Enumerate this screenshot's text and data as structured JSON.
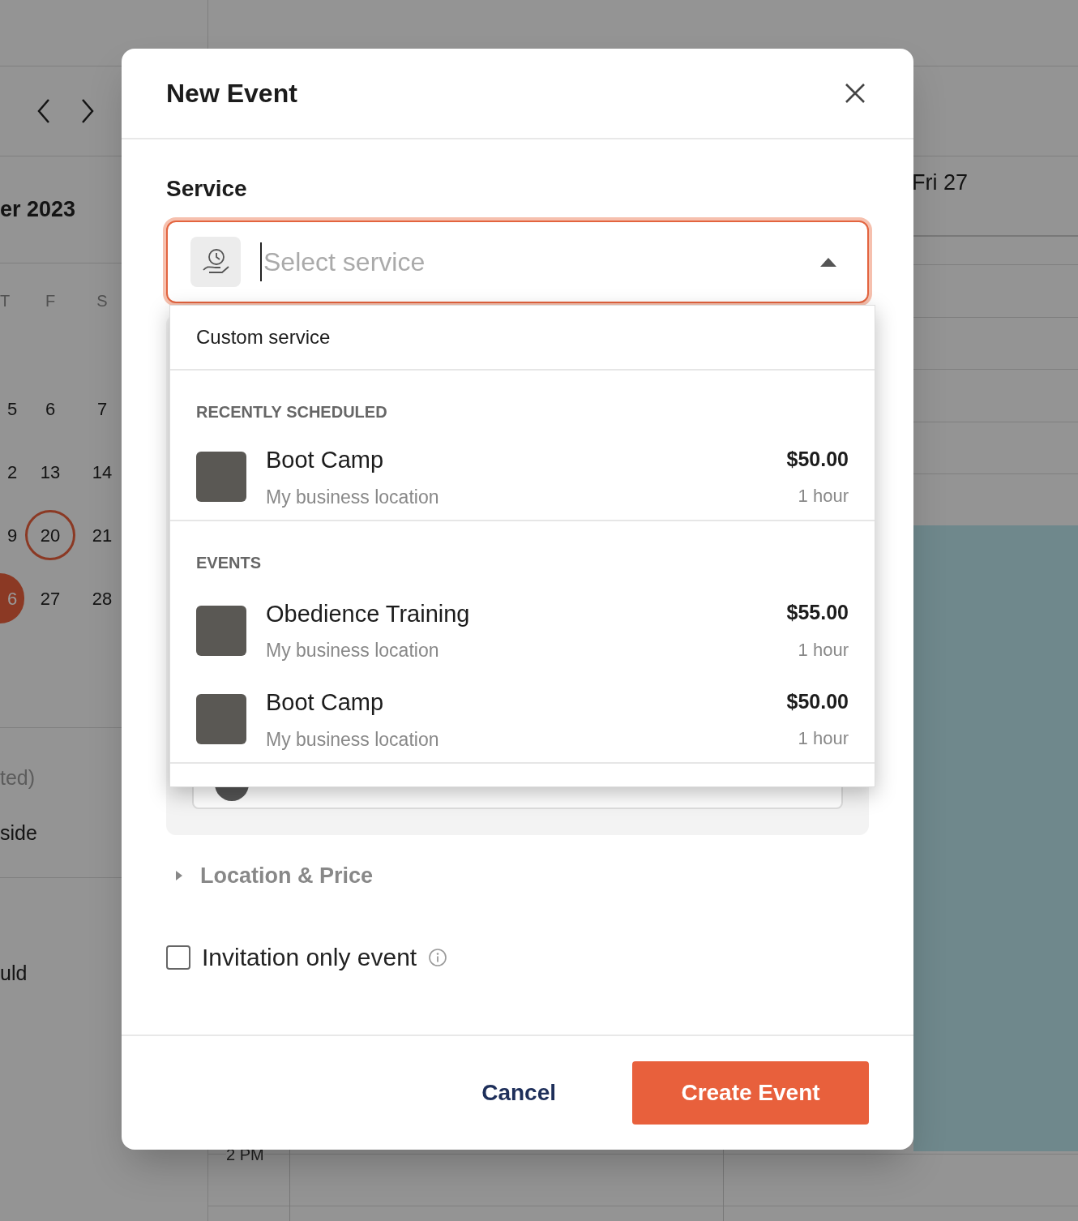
{
  "background": {
    "month_title": "er 2023",
    "weekday_headers": [
      "T",
      "F",
      "S"
    ],
    "weeks": [
      [
        {
          "label": "5",
          "today": false,
          "selected": false
        },
        {
          "label": "6",
          "today": false,
          "selected": false
        },
        {
          "label": "7",
          "today": false,
          "selected": false
        }
      ],
      [
        {
          "label": "2",
          "today": false,
          "selected": false
        },
        {
          "label": "13",
          "today": false,
          "selected": false
        },
        {
          "label": "14",
          "today": false,
          "selected": false
        }
      ],
      [
        {
          "label": "9",
          "today": false,
          "selected": false
        },
        {
          "label": "20",
          "today": true,
          "selected": false
        },
        {
          "label": "21",
          "today": false,
          "selected": false
        }
      ],
      [
        {
          "label": "6",
          "today": false,
          "selected": true
        },
        {
          "label": "27",
          "today": false,
          "selected": false
        },
        {
          "label": "28",
          "today": false,
          "selected": false
        }
      ]
    ],
    "sidebar_texts": [
      {
        "text": "ted)",
        "muted": true
      },
      {
        "text": "side",
        "muted": false
      },
      {
        "text": "uld",
        "muted": false
      }
    ],
    "day_header": "Fri 27",
    "time_label": "2 PM"
  },
  "modal": {
    "title": "New Event",
    "service": {
      "label": "Service",
      "placeholder": "Select service",
      "expanded": true,
      "options": [
        {
          "kind": "option",
          "title": "Custom service"
        },
        {
          "kind": "header",
          "title": "RECENTLY SCHEDULED"
        },
        {
          "kind": "service",
          "title": "Boot Camp",
          "location": "My business location",
          "price": "$50.00",
          "duration": "1 hour"
        },
        {
          "kind": "header",
          "title": "EVENTS"
        },
        {
          "kind": "service",
          "title": "Obedience Training",
          "location": "My business location",
          "price": "$55.00",
          "duration": "1 hour"
        },
        {
          "kind": "service",
          "title": "Boot Camp",
          "location": "My business location",
          "price": "$50.00",
          "duration": "1 hour"
        }
      ]
    },
    "location_price": {
      "label": "Location & Price",
      "expanded": false
    },
    "invitation_only": {
      "label": "Invitation only event",
      "checked": false
    },
    "buttons": [
      {
        "kind": "secondary",
        "label": "Cancel"
      },
      {
        "kind": "primary",
        "label": "Create Event"
      }
    ]
  }
}
